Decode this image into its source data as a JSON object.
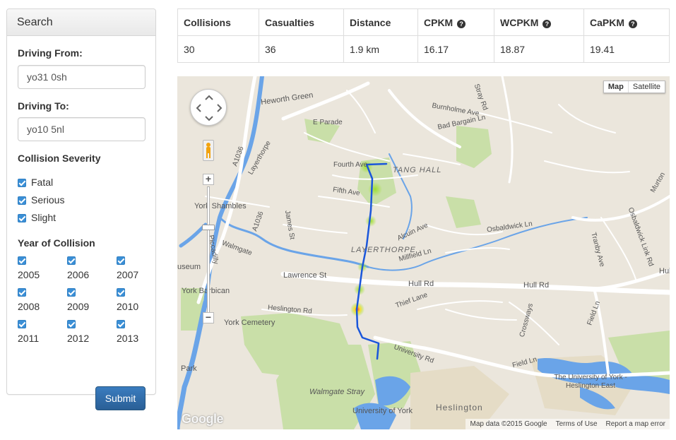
{
  "search": {
    "heading": "Search",
    "driving_from_label": "Driving From:",
    "driving_from_value": "yo31 0sh",
    "driving_to_label": "Driving To:",
    "driving_to_value": "yo10 5nl",
    "severity_label": "Collision Severity",
    "severities": [
      {
        "label": "Fatal",
        "checked": true
      },
      {
        "label": "Serious",
        "checked": true
      },
      {
        "label": "Slight",
        "checked": true
      }
    ],
    "year_label": "Year of Collision",
    "years": [
      {
        "label": "2005",
        "checked": true
      },
      {
        "label": "2006",
        "checked": true
      },
      {
        "label": "2007",
        "checked": true
      },
      {
        "label": "2008",
        "checked": true
      },
      {
        "label": "2009",
        "checked": true
      },
      {
        "label": "2010",
        "checked": true
      },
      {
        "label": "2011",
        "checked": true
      },
      {
        "label": "2012",
        "checked": true
      },
      {
        "label": "2013",
        "checked": true
      }
    ],
    "submit_label": "Submit"
  },
  "stats": {
    "headers": [
      {
        "label": "Collisions",
        "help": false
      },
      {
        "label": "Casualties",
        "help": false
      },
      {
        "label": "Distance",
        "help": false
      },
      {
        "label": "CPKM",
        "help": true
      },
      {
        "label": "WCPKM",
        "help": true
      },
      {
        "label": "CaPKM",
        "help": true
      }
    ],
    "values": [
      "30",
      "36",
      "1.9 km",
      "16.17",
      "18.87",
      "19.41"
    ]
  },
  "map": {
    "map_type_active": "Map",
    "map_type_other": "Satellite",
    "zoom_in": "+",
    "zoom_out": "−",
    "logo": "Google",
    "footer": {
      "data": "Map data ©2015 Google",
      "terms": "Terms of Use",
      "report": "Report a map error"
    },
    "labels": {
      "heworth_green": "Heworth Green",
      "e_parade": "E Parade",
      "stray_rd": "Stray Rd",
      "burnholme_ave": "Burnholme Ave",
      "bad_bargain_ln": "Bad Bargain Ln",
      "a1036_top": "A1036",
      "layerthorpe_road": "Layerthorpe",
      "fourth_ave": "Fourth Ave",
      "tang_hall": "TANG HALL",
      "fifth_ave": "Fifth Ave",
      "murton": "Murton",
      "york_shambles": "York Shambles",
      "a1036_mid": "A1036",
      "james_st": "James St",
      "alcuin_ave": "Alcuin Ave",
      "osbaldwick_ln": "Osbaldwick Ln",
      "osbaldwick_link_rd": "Osbaldwick Link Rd",
      "tranby_ave": "Tranby Ave",
      "walmgate": "Walmgate",
      "layerthorpe_district": "LAYERTHORPE",
      "millfield_ln": "Millfield Ln",
      "useum": "useum",
      "lawrence_st": "Lawrence St",
      "hull_rd_1": "Hull Rd",
      "hull_rd_2": "Hull Rd",
      "hull_rd_3": "Hull Rd",
      "york_barbican": "York Barbican",
      "thief_lane": "Thief Lane",
      "heslington_rd": "Heslington Rd",
      "field_ln_1": "Field Ln",
      "crossways": "Crossways",
      "york_cemetery": "York Cemetery",
      "university_rd": "University Rd",
      "field_ln_2": "Field Ln",
      "park": "Park",
      "uni_york_east": "The University of York - Heslington East",
      "walmgate_stray": "Walmgate Stray",
      "heslington": "Heslington",
      "university_of_york": "University of York",
      "piccadilly": "Piccadilly"
    }
  }
}
